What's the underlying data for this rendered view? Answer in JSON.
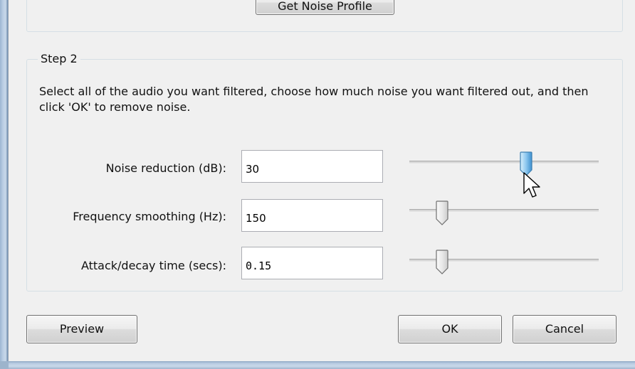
{
  "step1": {
    "get_noise_profile_label": "Get Noise Profile"
  },
  "step2": {
    "legend": "Step 2",
    "instructions": "Select all of the audio you want filtered, choose how much noise you want filtered out, and then click 'OK' to remove noise.",
    "rows": [
      {
        "label": "Noise reduction (dB):",
        "value": "30",
        "slider_level": 0.63,
        "slider_state": "hot"
      },
      {
        "label": "Frequency smoothing (Hz):",
        "value": "150",
        "slider_level": 0.18,
        "slider_state": "normal"
      },
      {
        "label": "Attack/decay time (secs):",
        "value": "0.15",
        "slider_level": 0.18,
        "slider_state": "normal"
      }
    ]
  },
  "buttons": {
    "preview": "Preview",
    "ok": "OK",
    "cancel": "Cancel"
  },
  "icons": {
    "cursor": "arrow-cursor-icon",
    "thumb": "slider-thumb-icon"
  },
  "colors": {
    "dialog_background": "#f0f0f0",
    "window_frame": "#b9cde3",
    "group_border": "#d5dfe5",
    "thumb_hot": "#5ea6d8"
  }
}
